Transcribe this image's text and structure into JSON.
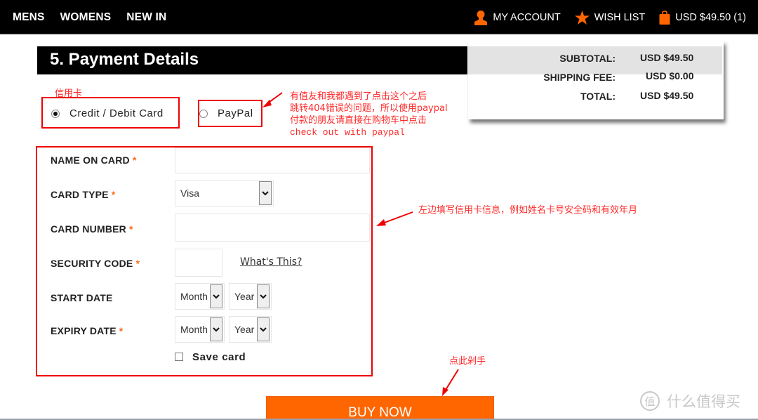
{
  "nav": {
    "left": [
      "MENS",
      "WOMENS",
      "NEW IN"
    ],
    "account_label": "MY ACCOUNT",
    "wishlist_label": "WISH LIST",
    "cart_label": "USD $49.50 (1)",
    "accent_color": "#ff6600"
  },
  "section": {
    "title": "5. Payment Details"
  },
  "summary": {
    "subtotal_label": "SUBTOTAL:",
    "subtotal_value": "USD $49.50",
    "shipping_label": "SHIPPING FEE:",
    "shipping_value": "USD $0.00",
    "total_label": "TOTAL:",
    "total_value": "USD $49.50"
  },
  "payment_methods": {
    "credit": {
      "label": "Credit / Debit Card",
      "selected": true
    },
    "paypal": {
      "label": "PayPal",
      "selected": false
    }
  },
  "form": {
    "required_mark": "*",
    "name_on_card": {
      "label": "NAME ON CARD",
      "value": ""
    },
    "card_type": {
      "label": "CARD TYPE",
      "value": "Visa"
    },
    "card_number": {
      "label": "CARD NUMBER",
      "value": ""
    },
    "security_code": {
      "label": "SECURITY CODE",
      "value": "",
      "help_link": "What's This?"
    },
    "start_date": {
      "label": "START DATE",
      "month": "Month",
      "year": "Year"
    },
    "expiry_date": {
      "label": "EXPIRY DATE",
      "month": "Month",
      "year": "Year"
    },
    "save_card": {
      "label": "Save card",
      "checked": false
    }
  },
  "buy_button": "BUY NOW",
  "annotations": {
    "credit_card": "信用卡",
    "paypal_note_lines": [
      "有值友和我都遇到了点击这个之后",
      "跳转404错误的问题，所以使用paypal",
      "付款的朋友请直接在购物车中点击",
      "check out with paypal"
    ],
    "form_note": "左边填写信用卡信息，例如姓名卡号安全码和有效年月",
    "buy_note": "点此剁手",
    "annotation_color": "#ff2a2a"
  },
  "watermark": {
    "badge": "值",
    "text": "什么值得买"
  }
}
